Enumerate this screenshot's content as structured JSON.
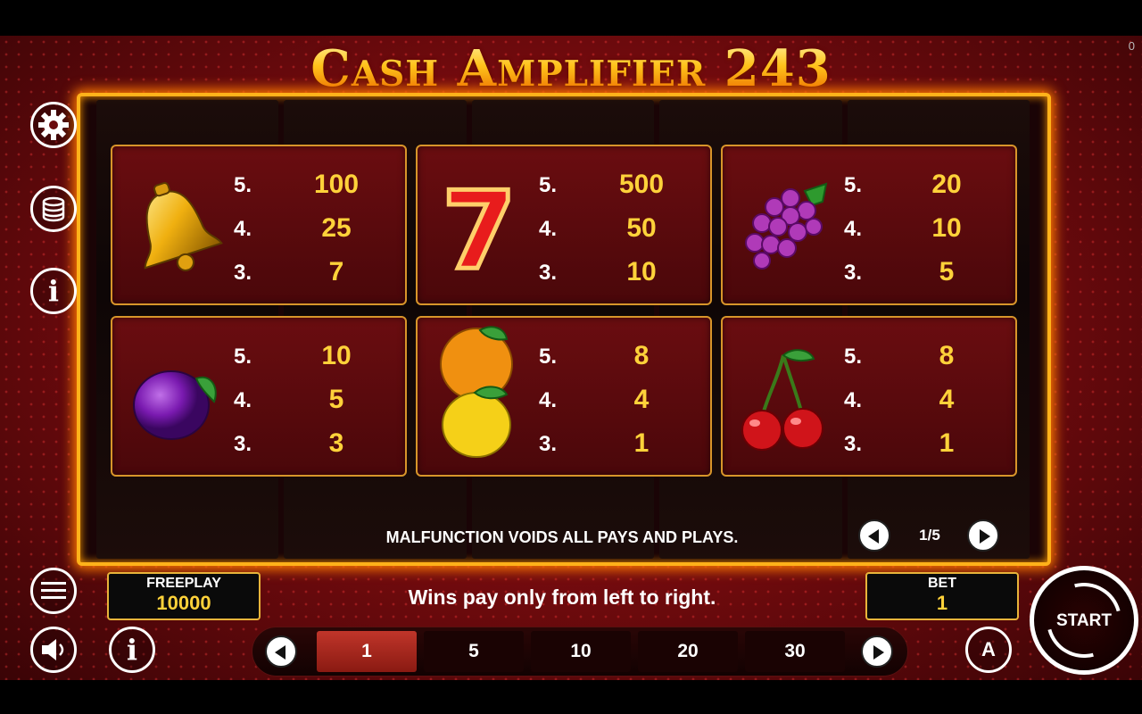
{
  "title": "Cash Amplifier 243",
  "counter": "0",
  "paytable": [
    {
      "symbol": "bell-icon",
      "rows": [
        {
          "k": "5.",
          "v": "100"
        },
        {
          "k": "4.",
          "v": "25"
        },
        {
          "k": "3.",
          "v": "7"
        }
      ]
    },
    {
      "symbol": "seven-icon",
      "rows": [
        {
          "k": "5.",
          "v": "500"
        },
        {
          "k": "4.",
          "v": "50"
        },
        {
          "k": "3.",
          "v": "10"
        }
      ]
    },
    {
      "symbol": "grapes-icon",
      "rows": [
        {
          "k": "5.",
          "v": "20"
        },
        {
          "k": "4.",
          "v": "10"
        },
        {
          "k": "3.",
          "v": "5"
        }
      ]
    },
    {
      "symbol": "plum-icon",
      "rows": [
        {
          "k": "5.",
          "v": "10"
        },
        {
          "k": "4.",
          "v": "5"
        },
        {
          "k": "3.",
          "v": "3"
        }
      ]
    },
    {
      "symbol": "orange-lemon-icon",
      "rows": [
        {
          "k": "5.",
          "v": "8"
        },
        {
          "k": "4.",
          "v": "4"
        },
        {
          "k": "3.",
          "v": "1"
        }
      ]
    },
    {
      "symbol": "cherries-icon",
      "rows": [
        {
          "k": "5.",
          "v": "8"
        },
        {
          "k": "4.",
          "v": "4"
        },
        {
          "k": "3.",
          "v": "1"
        }
      ]
    }
  ],
  "malfunction": "MALFUNCTION VOIDS ALL PAYS AND PLAYS.",
  "page_label": "1/5",
  "freeplay": {
    "label": "FREEPLAY",
    "value": "10000"
  },
  "bet": {
    "label": "BET",
    "value": "1"
  },
  "wins_note": "Wins pay only from left to right.",
  "bet_options": [
    "1",
    "5",
    "10",
    "20",
    "30"
  ],
  "selected_bet": "1",
  "start_label": "START",
  "auto_label": "A",
  "seven_glyph": "7",
  "info_glyph": "i",
  "colors": {
    "accent": "#ffd23a",
    "frame": "#ffb21a",
    "card": "#5a0a0d"
  }
}
